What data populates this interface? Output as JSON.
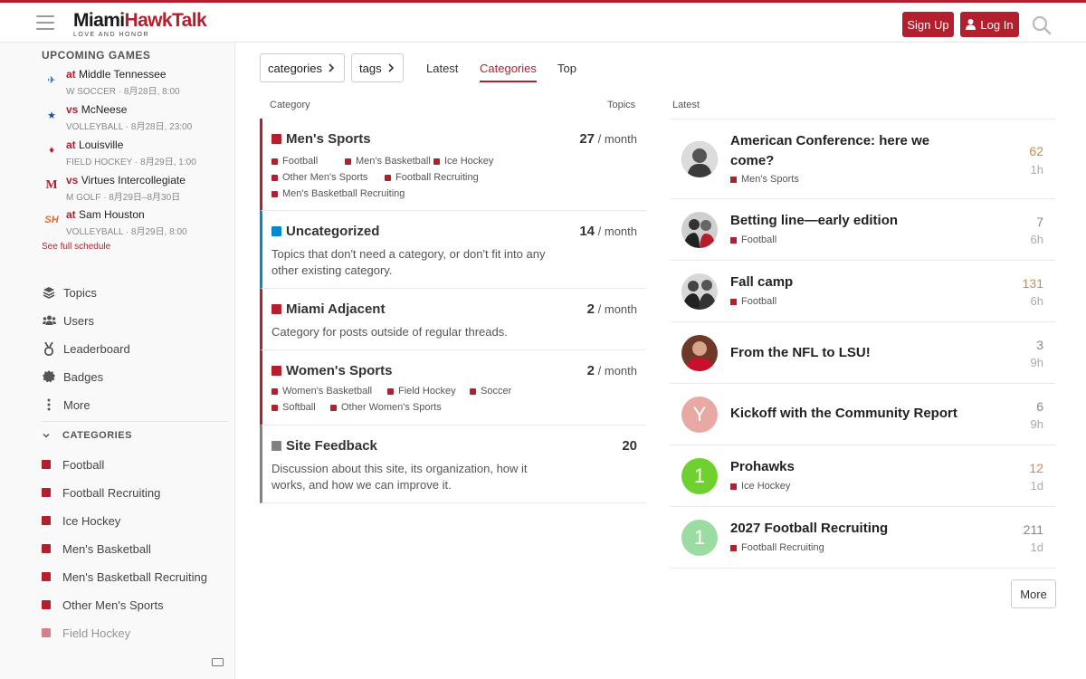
{
  "header": {
    "logo_part1": "Miami",
    "logo_part2": "HawkTalk",
    "logo_tagline": "LOVE AND HONOR",
    "signup_label": "Sign Up",
    "login_label": "Log In",
    "accent_color": "#b41f2e"
  },
  "sidebar": {
    "upcoming_heading": "UPCOMING GAMES",
    "games": [
      {
        "prefix": "at",
        "opponent": "Middle Tennessee",
        "meta": "W SOCCER · 8月28日, 8:00",
        "logo": "MT"
      },
      {
        "prefix": "vs",
        "opponent": "McNeese",
        "meta": "VOLLEYBALL · 8月28日, 23:00",
        "logo": "MN"
      },
      {
        "prefix": "at",
        "opponent": "Louisville",
        "meta": "FIELD HOCKEY · 8月29日, 1:00",
        "logo": "L"
      },
      {
        "prefix": "vs",
        "opponent": "Virtues Intercollegiate",
        "meta": "M GOLF · 8月29日–8月30日",
        "logo": "M"
      },
      {
        "prefix": "at",
        "opponent": "Sam Houston",
        "meta": "VOLLEYBALL · 8月29日, 8:00",
        "logo": "SH"
      }
    ],
    "see_schedule": "See full schedule",
    "nav": [
      {
        "label": "Topics",
        "icon": "layers-icon"
      },
      {
        "label": "Users",
        "icon": "users-icon"
      },
      {
        "label": "Leaderboard",
        "icon": "award-icon"
      },
      {
        "label": "Badges",
        "icon": "badge-icon"
      },
      {
        "label": "More",
        "icon": "ellipsis-vertical-icon"
      }
    ],
    "categories_heading": "CATEGORIES",
    "categories": [
      "Football",
      "Football Recruiting",
      "Ice Hockey",
      "Men's Basketball",
      "Men's Basketball Recruiting",
      "Other Men's Sports",
      "Field Hockey"
    ]
  },
  "filters": {
    "categories_chip": "categories",
    "tags_chip": "tags",
    "tabs": [
      "Latest",
      "Categories",
      "Top"
    ]
  },
  "category_table": {
    "col_category": "Category",
    "col_topics": "Topics",
    "rows": [
      {
        "name": "Men's Sports",
        "count": "27",
        "unit": "/ month",
        "color": "#b41f2e",
        "desc": "",
        "subs": [
          "Football",
          "Men's Basketball",
          "Ice Hockey",
          "Other Men's Sports",
          "Football Recruiting",
          "Men's Basketball Recruiting"
        ]
      },
      {
        "name": "Uncategorized",
        "count": "14",
        "unit": "/ month",
        "color": "#0088cc",
        "desc": "Topics that don't need a category, or don't fit into any other existing category.",
        "subs": []
      },
      {
        "name": "Miami Adjacent",
        "count": "2",
        "unit": "/ month",
        "color": "#b41f2e",
        "desc": "Category for posts outside of regular threads.",
        "subs": []
      },
      {
        "name": "Women's Sports",
        "count": "2",
        "unit": "/ month",
        "color": "#b41f2e",
        "desc": "",
        "subs": [
          "Women's Basketball",
          "Field Hockey",
          "Soccer",
          "Softball",
          "Other Women's Sports"
        ]
      },
      {
        "name": "Site Feedback",
        "count": "20",
        "unit": "",
        "color": "#808281",
        "desc": "Discussion about this site, its organization, how it works, and how we can improve it.",
        "subs": []
      }
    ]
  },
  "latest": {
    "heading": "Latest",
    "topics": [
      {
        "title": "American Conference: here we come?",
        "category": "Men's Sports",
        "replies": "62",
        "age": "1h",
        "hot": true,
        "avatar": "",
        "avatar_color": "#6b6b6b"
      },
      {
        "title": "Betting line—early edition",
        "category": "Football",
        "replies": "7",
        "age": "6h",
        "hot": false,
        "avatar": "",
        "avatar_color": "#5a5a5a"
      },
      {
        "title": "Fall camp",
        "category": "Football",
        "replies": "131",
        "age": "6h",
        "hot": true,
        "avatar": "",
        "avatar_color": "#707070"
      },
      {
        "title": "From the NFL to LSU!",
        "category": "",
        "replies": "3",
        "age": "9h",
        "hot": false,
        "avatar": "",
        "avatar_color": "#8a4a3a"
      },
      {
        "title": "Kickoff with the Community Report",
        "category": "",
        "replies": "6",
        "age": "9h",
        "hot": false,
        "avatar": "Y",
        "avatar_color": "#e8a9a4"
      },
      {
        "title": "Prohawks",
        "category": "Ice Hockey",
        "replies": "12",
        "age": "1d",
        "hot": true,
        "avatar": "1",
        "avatar_color": "#6ed12f"
      },
      {
        "title": "2027 Football Recruiting",
        "category": "Football Recruiting",
        "replies": "211",
        "age": "1d",
        "hot": false,
        "avatar": "1",
        "avatar_color": "#9bdca2"
      }
    ],
    "more_label": "More"
  }
}
